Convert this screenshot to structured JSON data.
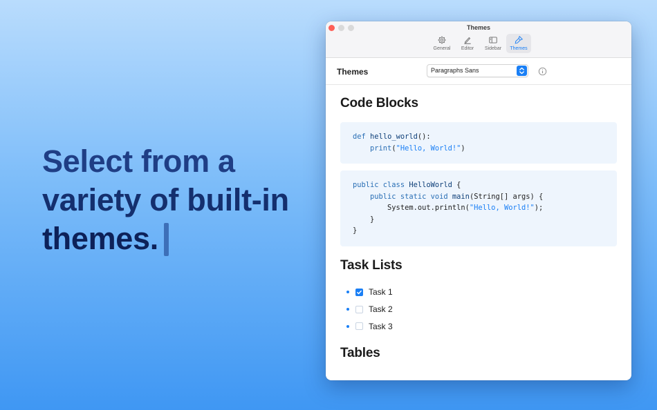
{
  "hero": {
    "line1": "Select from a",
    "line2": "variety of built-in",
    "line3": "themes."
  },
  "window": {
    "title": "Themes",
    "toolbar": [
      {
        "label": "General",
        "icon": "gear-icon"
      },
      {
        "label": "Editor",
        "icon": "pen-icon"
      },
      {
        "label": "Sidebar",
        "icon": "sidebar-icon"
      },
      {
        "label": "Themes",
        "icon": "brush-icon",
        "active": true
      }
    ],
    "settings": {
      "label": "Themes",
      "selected_theme": "Paragraphs Sans"
    },
    "preview": {
      "code_heading": "Code Blocks",
      "python": {
        "l1_kw": "def",
        "l1_fn": "hello_world",
        "l1_rest": "():",
        "l2_fn": "print",
        "l2_open": "(",
        "l2_str": "\"Hello, World!\"",
        "l2_close": ")"
      },
      "java": {
        "l1_kw": "public class",
        "l1_name": "HelloWorld",
        "l1_rest": "{",
        "l2_kw": "public static void",
        "l2_fn": "main",
        "l2_rest": "(String[] args) {",
        "l3_pre": "System.out.println(",
        "l3_str": "\"Hello, World!\"",
        "l3_post": ");",
        "l4": "}",
        "l5": "}"
      },
      "tasks_heading": "Task Lists",
      "tasks": [
        {
          "label": "Task 1",
          "checked": true
        },
        {
          "label": "Task 2",
          "checked": false
        },
        {
          "label": "Task 3",
          "checked": false
        }
      ],
      "tables_heading": "Tables"
    }
  },
  "colors": {
    "accent": "#1a7ff5",
    "code_bg": "#eef5fd",
    "headline": "#142f6e"
  }
}
